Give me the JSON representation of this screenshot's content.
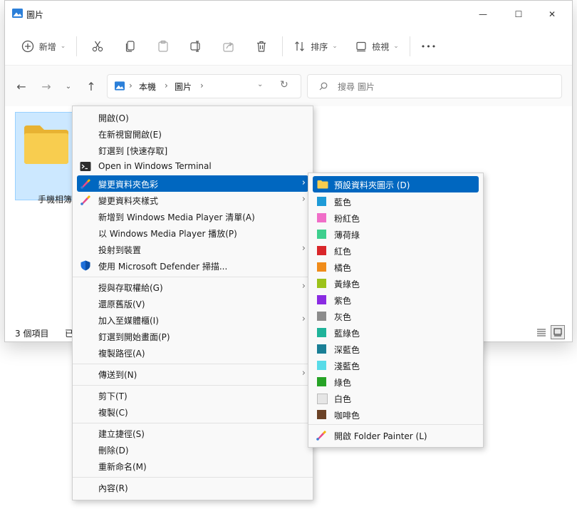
{
  "window": {
    "title": "圖片",
    "controls": {
      "minimize": "—",
      "maximize": "☐",
      "close": "✕"
    }
  },
  "toolbar": {
    "new_label": "新增",
    "sort_label": "排序",
    "view_label": "檢視",
    "more_label": "•••"
  },
  "navbar": {
    "breadcrumb": [
      "本機",
      "圖片"
    ],
    "search_placeholder": "搜尋 圖片"
  },
  "content": {
    "folder_name": "手機相簿"
  },
  "statusbar": {
    "item_count": "3 個項目",
    "selected_fragment": "已"
  },
  "context_menu": {
    "items": [
      {
        "label": "開啟(O)",
        "icon": "none"
      },
      {
        "label": "在新視窗開啟(E)",
        "icon": "none"
      },
      {
        "label": "釘選到 [快速存取]",
        "icon": "none"
      },
      {
        "label": "Open in Windows Terminal",
        "icon": "terminal-icon"
      },
      {
        "label": "變更資料夾色彩",
        "icon": "folder-painter-icon",
        "submenu": true,
        "highlighted": true
      },
      {
        "label": "變更資料夾樣式",
        "icon": "folder-painter-icon",
        "submenu": true
      },
      {
        "label": "新增到 Windows Media Player 清單(A)",
        "icon": "none"
      },
      {
        "label": "以 Windows Media Player 播放(P)",
        "icon": "none"
      },
      {
        "label": "投射到裝置",
        "icon": "none",
        "submenu": true
      },
      {
        "label": "使用 Microsoft Defender 掃描...",
        "icon": "defender-shield-icon"
      },
      {
        "label": "授與存取權給(G)",
        "icon": "none",
        "submenu": true
      },
      {
        "label": "還原舊版(V)",
        "icon": "none"
      },
      {
        "label": "加入至媒體櫃(I)",
        "icon": "none",
        "submenu": true
      },
      {
        "label": "釘選到開始畫面(P)",
        "icon": "none"
      },
      {
        "label": "複製路徑(A)",
        "icon": "none"
      },
      {
        "label": "傳送到(N)",
        "icon": "none",
        "submenu": true
      },
      {
        "label": "剪下(T)",
        "icon": "none"
      },
      {
        "label": "複製(C)",
        "icon": "none"
      },
      {
        "label": "建立捷徑(S)",
        "icon": "none"
      },
      {
        "label": "刪除(D)",
        "icon": "none"
      },
      {
        "label": "重新命名(M)",
        "icon": "none"
      },
      {
        "label": "內容(R)",
        "icon": "none"
      }
    ]
  },
  "color_submenu": {
    "default_label": "預設資料夾圖示 (D)",
    "colors": [
      {
        "label": "藍色",
        "color": "#1e9bd7"
      },
      {
        "label": "粉紅色",
        "color": "#f06ec8"
      },
      {
        "label": "薄荷綠",
        "color": "#3ecf8e"
      },
      {
        "label": "紅色",
        "color": "#d9262a"
      },
      {
        "label": "橘色",
        "color": "#f08c1a"
      },
      {
        "label": "黃綠色",
        "color": "#9cc21a"
      },
      {
        "label": "紫色",
        "color": "#8a2be2"
      },
      {
        "label": "灰色",
        "color": "#8c8c8c"
      },
      {
        "label": "藍綠色",
        "color": "#1fb39a"
      },
      {
        "label": "深藍色",
        "color": "#1a7f96"
      },
      {
        "label": "淺藍色",
        "color": "#58dbe8"
      },
      {
        "label": "綠色",
        "color": "#26a326"
      },
      {
        "label": "白色",
        "color": "#e6e6e6"
      },
      {
        "label": "咖啡色",
        "color": "#6b4226"
      }
    ],
    "folder_painter_label": "開啟 Folder Painter (L)"
  },
  "colors": {
    "accent": "#0067c0",
    "folder_yellow": "#f8cd4f"
  }
}
